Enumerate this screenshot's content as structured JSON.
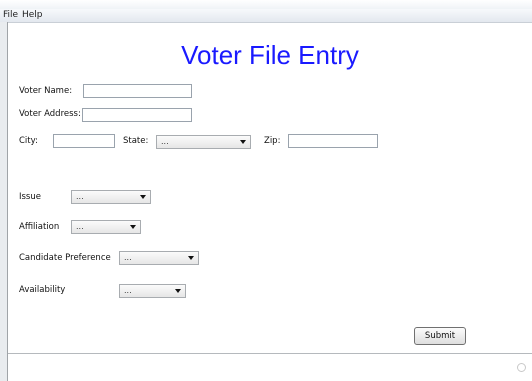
{
  "menu": {
    "file": "File",
    "help": "Help"
  },
  "form": {
    "title": "Voter File Entry",
    "voter_name_label": "Voter Name:",
    "voter_name_value": "",
    "voter_address_label": "Voter Address:",
    "voter_address_value": "",
    "city_label": "City:",
    "city_value": "",
    "state_label": "State:",
    "state_value": "...",
    "zip_label": "Zip:",
    "zip_value": "",
    "issue_label": "Issue",
    "issue_value": "...",
    "affiliation_label": "Affiliation",
    "affiliation_value": "...",
    "candidate_label": "Candidate Preference",
    "candidate_value": "...",
    "availability_label": "Availability",
    "availability_value": "...",
    "submit_label": "Submit"
  },
  "colors": {
    "title": "#1a1aff",
    "background": "#ffffff"
  }
}
